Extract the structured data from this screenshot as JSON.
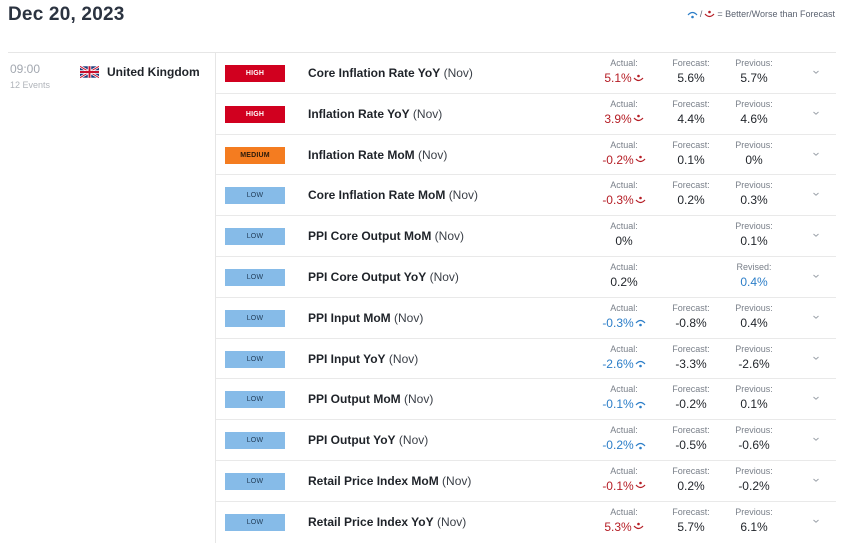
{
  "header": {
    "date": "Dec 20, 2023",
    "legend_text": "= Better/Worse than Forecast",
    "legend_separator": "/"
  },
  "colors": {
    "high": "#d1001f",
    "medium": "#f47c20",
    "low": "#86bbe8",
    "better": "#2c7ec8",
    "worse": "#b51d25"
  },
  "group": {
    "time": "09:00",
    "events_count": "12 Events",
    "country": "United Kingdom",
    "flag_icon": "uk-flag-icon"
  },
  "labels": {
    "actual": "Actual:",
    "forecast": "Forecast:",
    "previous": "Previous:",
    "revised": "Revised:"
  },
  "events": [
    {
      "impact": "HIGH",
      "impact_level": "high",
      "name": "Core Inflation Rate YoY",
      "period": "(Nov)",
      "actual": "5.1%",
      "actual_status": "worse",
      "forecast": "5.6%",
      "previous_label": "Previous:",
      "previous": "5.7%",
      "previous_status": ""
    },
    {
      "impact": "HIGH",
      "impact_level": "high",
      "name": "Inflation Rate YoY",
      "period": "(Nov)",
      "actual": "3.9%",
      "actual_status": "worse",
      "forecast": "4.4%",
      "previous_label": "Previous:",
      "previous": "4.6%",
      "previous_status": ""
    },
    {
      "impact": "MEDIUM",
      "impact_level": "medium",
      "name": "Inflation Rate MoM",
      "period": "(Nov)",
      "actual": "-0.2%",
      "actual_status": "worse",
      "forecast": "0.1%",
      "previous_label": "Previous:",
      "previous": "0%",
      "previous_status": ""
    },
    {
      "impact": "LOW",
      "impact_level": "low",
      "name": "Core Inflation Rate MoM",
      "period": "(Nov)",
      "actual": "-0.3%",
      "actual_status": "worse",
      "forecast": "0.2%",
      "previous_label": "Previous:",
      "previous": "0.3%",
      "previous_status": ""
    },
    {
      "impact": "LOW",
      "impact_level": "low",
      "name": "PPI Core Output MoM",
      "period": "(Nov)",
      "actual": "0%",
      "actual_status": "",
      "forecast": "",
      "previous_label": "Previous:",
      "previous": "0.1%",
      "previous_status": ""
    },
    {
      "impact": "LOW",
      "impact_level": "low",
      "name": "PPI Core Output YoY",
      "period": "(Nov)",
      "actual": "0.2%",
      "actual_status": "",
      "forecast": "",
      "previous_label": "Revised:",
      "previous": "0.4%",
      "previous_status": "better"
    },
    {
      "impact": "LOW",
      "impact_level": "low",
      "name": "PPI Input MoM",
      "period": "(Nov)",
      "actual": "-0.3%",
      "actual_status": "better",
      "forecast": "-0.8%",
      "previous_label": "Previous:",
      "previous": "0.4%",
      "previous_status": ""
    },
    {
      "impact": "LOW",
      "impact_level": "low",
      "name": "PPI Input YoY",
      "period": "(Nov)",
      "actual": "-2.6%",
      "actual_status": "better",
      "forecast": "-3.3%",
      "previous_label": "Previous:",
      "previous": "-2.6%",
      "previous_status": ""
    },
    {
      "impact": "LOW",
      "impact_level": "low",
      "name": "PPI Output MoM",
      "period": "(Nov)",
      "actual": "-0.1%",
      "actual_status": "better",
      "forecast": "-0.2%",
      "previous_label": "Previous:",
      "previous": "0.1%",
      "previous_status": ""
    },
    {
      "impact": "LOW",
      "impact_level": "low",
      "name": "PPI Output YoY",
      "period": "(Nov)",
      "actual": "-0.2%",
      "actual_status": "better",
      "forecast": "-0.5%",
      "previous_label": "Previous:",
      "previous": "-0.6%",
      "previous_status": ""
    },
    {
      "impact": "LOW",
      "impact_level": "low",
      "name": "Retail Price Index MoM",
      "period": "(Nov)",
      "actual": "-0.1%",
      "actual_status": "worse",
      "forecast": "0.2%",
      "previous_label": "Previous:",
      "previous": "-0.2%",
      "previous_status": ""
    },
    {
      "impact": "LOW",
      "impact_level": "low",
      "name": "Retail Price Index YoY",
      "period": "(Nov)",
      "actual": "5.3%",
      "actual_status": "worse",
      "forecast": "5.7%",
      "previous_label": "Previous:",
      "previous": "6.1%",
      "previous_status": ""
    }
  ]
}
